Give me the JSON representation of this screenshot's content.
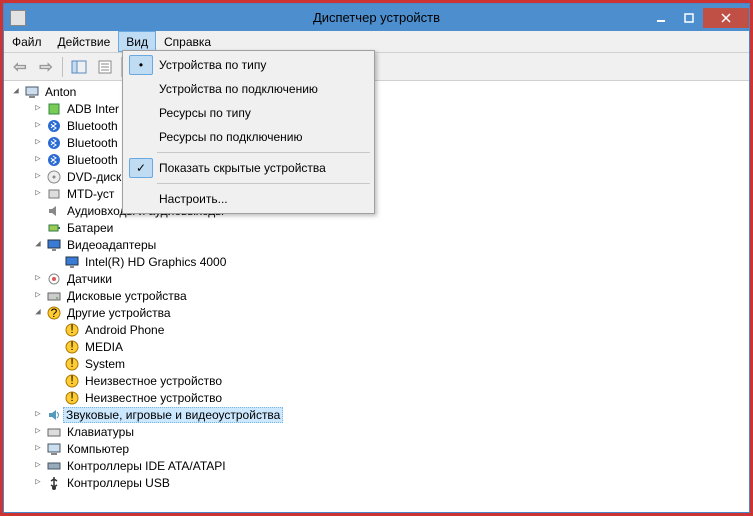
{
  "window": {
    "title": "Диспетчер устройств"
  },
  "menubar": {
    "items": [
      "Файл",
      "Действие",
      "Вид",
      "Справка"
    ],
    "active_index": 2
  },
  "dropdown": {
    "items": [
      {
        "label": "Устройства по типу",
        "type": "radio",
        "checked": true
      },
      {
        "label": "Устройства по подключению",
        "type": "radio",
        "checked": false
      },
      {
        "label": "Ресурсы по типу",
        "type": "radio",
        "checked": false
      },
      {
        "label": "Ресурсы по подключению",
        "type": "radio",
        "checked": false
      },
      {
        "type": "sep"
      },
      {
        "label": "Показать скрытые устройства",
        "type": "check",
        "checked": true
      },
      {
        "type": "sep"
      },
      {
        "label": "Настроить...",
        "type": "plain"
      }
    ]
  },
  "tree": {
    "root": "Anton",
    "nodes": [
      {
        "depth": 1,
        "exp": "closed",
        "icon": "adb",
        "label": "ADB Inter"
      },
      {
        "depth": 1,
        "exp": "closed",
        "icon": "bt",
        "label": "Bluetooth"
      },
      {
        "depth": 1,
        "exp": "closed",
        "icon": "bt",
        "label": "Bluetooth"
      },
      {
        "depth": 1,
        "exp": "closed",
        "icon": "bt",
        "label": "Bluetooth"
      },
      {
        "depth": 1,
        "exp": "closed",
        "icon": "dvd",
        "label": "DVD-диск"
      },
      {
        "depth": 1,
        "exp": "closed",
        "icon": "mtd",
        "label": "MTD-уст"
      },
      {
        "depth": 1,
        "exp": "none",
        "icon": "audio",
        "label": "Аудиовходы и аудиовыходы"
      },
      {
        "depth": 1,
        "exp": "none",
        "icon": "battery",
        "label": "Батареи"
      },
      {
        "depth": 1,
        "exp": "open",
        "icon": "display",
        "label": "Видеоадаптеры"
      },
      {
        "depth": 2,
        "exp": "none",
        "icon": "display",
        "label": "Intel(R) HD Graphics 4000"
      },
      {
        "depth": 1,
        "exp": "closed",
        "icon": "sensor",
        "label": "Датчики"
      },
      {
        "depth": 1,
        "exp": "closed",
        "icon": "disk",
        "label": "Дисковые устройства"
      },
      {
        "depth": 1,
        "exp": "open",
        "icon": "other",
        "label": "Другие устройства"
      },
      {
        "depth": 2,
        "exp": "none",
        "icon": "warn",
        "label": "Android Phone"
      },
      {
        "depth": 2,
        "exp": "none",
        "icon": "warn",
        "label": "MEDIA"
      },
      {
        "depth": 2,
        "exp": "none",
        "icon": "warn",
        "label": "System"
      },
      {
        "depth": 2,
        "exp": "none",
        "icon": "warn",
        "label": "Неизвестное устройство"
      },
      {
        "depth": 2,
        "exp": "none",
        "icon": "warn",
        "label": "Неизвестное устройство"
      },
      {
        "depth": 1,
        "exp": "closed",
        "icon": "sound",
        "label": "Звуковые, игровые и видеоустройства",
        "selected": true
      },
      {
        "depth": 1,
        "exp": "closed",
        "icon": "keyboard",
        "label": "Клавиатуры"
      },
      {
        "depth": 1,
        "exp": "closed",
        "icon": "computer",
        "label": "Компьютер"
      },
      {
        "depth": 1,
        "exp": "closed",
        "icon": "ide",
        "label": "Контроллеры IDE ATA/ATAPI"
      },
      {
        "depth": 1,
        "exp": "closed",
        "icon": "usb",
        "label": "Контроллеры USB"
      }
    ]
  }
}
